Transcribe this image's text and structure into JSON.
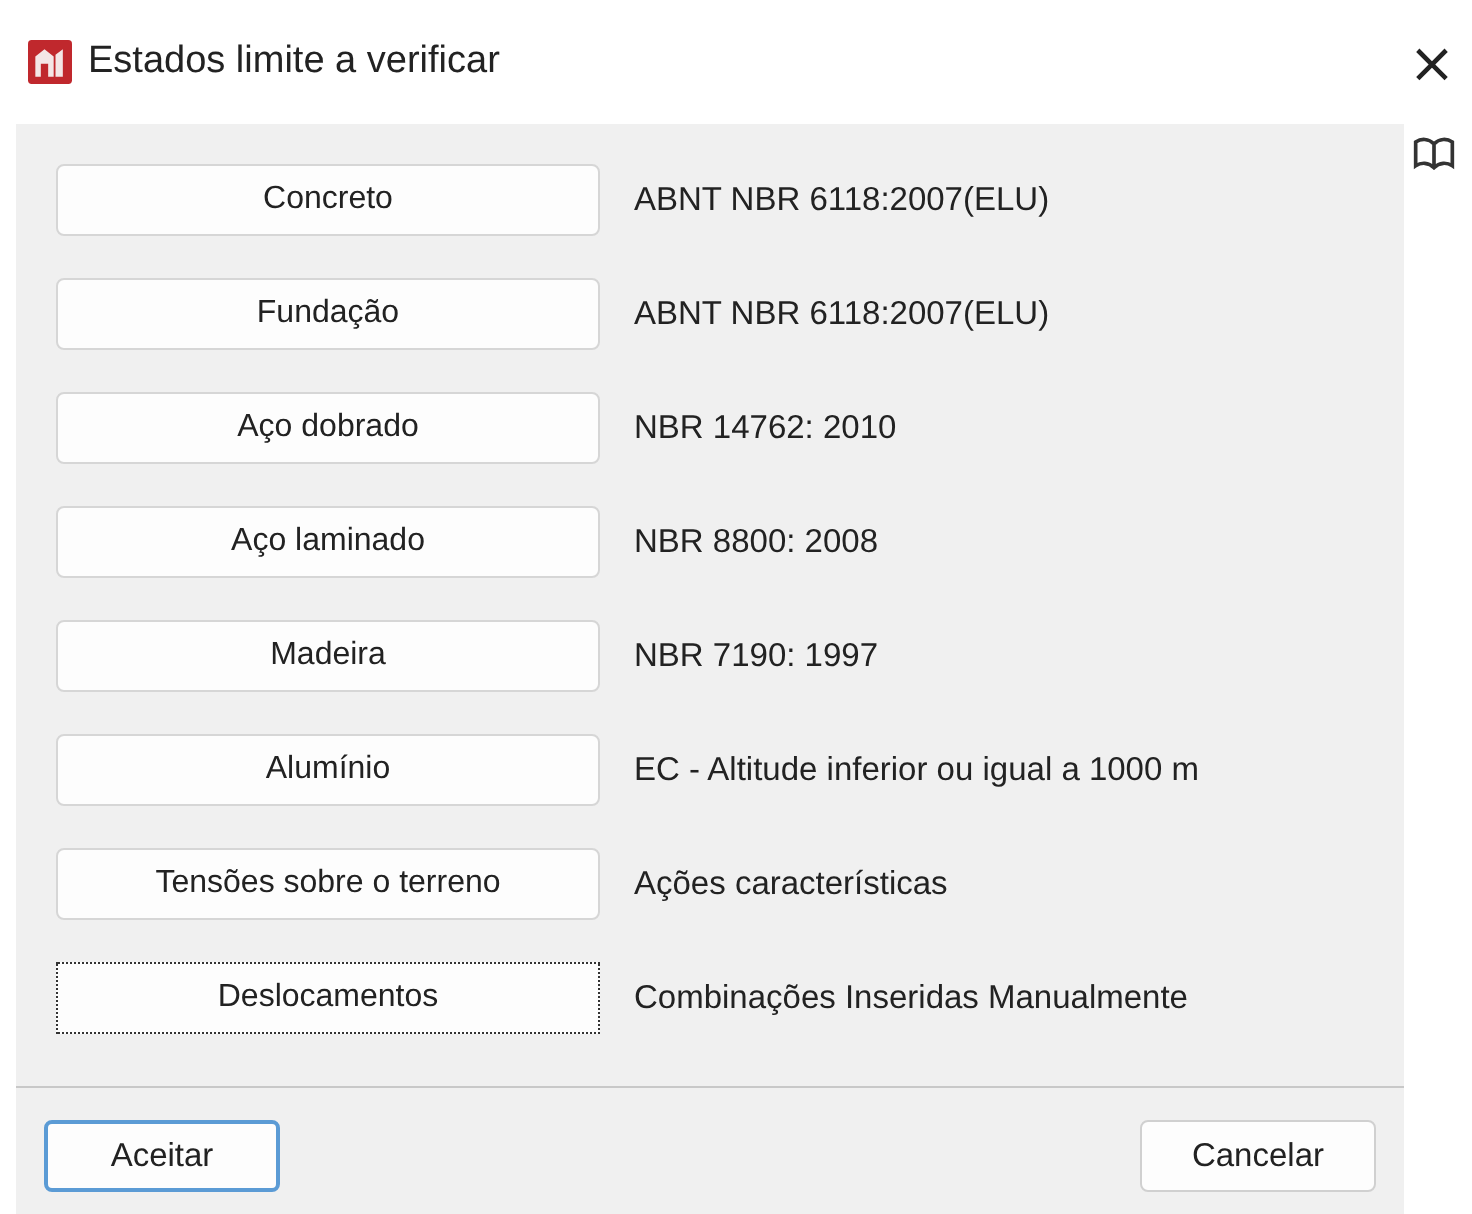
{
  "window": {
    "title": "Estados limite a verificar",
    "close": "×"
  },
  "rows": [
    {
      "button": "Concreto",
      "standard": "ABNT NBR 6118:2007(ELU)",
      "focused": false
    },
    {
      "button": "Fundação",
      "standard": "ABNT NBR 6118:2007(ELU)",
      "focused": false
    },
    {
      "button": "Aço dobrado",
      "standard": "NBR 14762: 2010",
      "focused": false
    },
    {
      "button": "Aço laminado",
      "standard": "NBR 8800: 2008",
      "focused": false
    },
    {
      "button": "Madeira",
      "standard": "NBR 7190: 1997",
      "focused": false
    },
    {
      "button": "Alumínio",
      "standard": "EC - Altitude inferior ou igual a 1000 m",
      "focused": false
    },
    {
      "button": "Tensões sobre o terreno",
      "standard": "Ações características",
      "focused": false
    },
    {
      "button": "Deslocamentos",
      "standard": "Combinações Inseridas Manualmente",
      "focused": true
    }
  ],
  "buttons": [
    {
      "label": "Aceitar",
      "default": true
    },
    {
      "label": "Cancelar",
      "default": false
    }
  ]
}
